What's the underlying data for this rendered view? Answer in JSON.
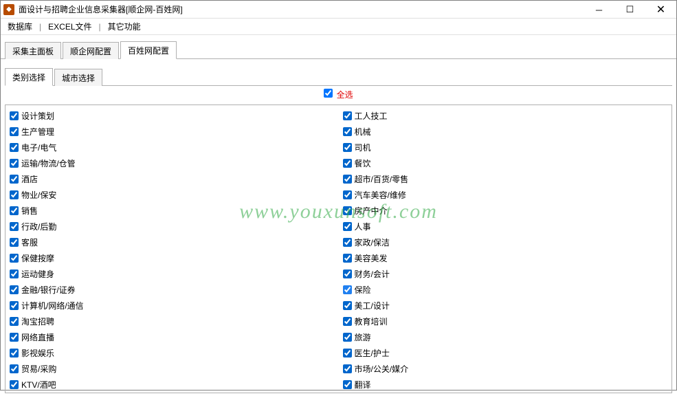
{
  "window": {
    "title": "面设计与招聘企业信息采集器[顺企网-百姓网]"
  },
  "menu": {
    "database": "数据库",
    "excel": "EXCEL文件",
    "other": "其它功能"
  },
  "tabs_main": {
    "collect": "采集主面板",
    "shunqi": "顺企网配置",
    "baixing": "百姓网配置"
  },
  "tabs_inner": {
    "category": "类别选择",
    "city": "城市选择"
  },
  "select_all": "全选",
  "watermark": "www.youxunsoft.com",
  "categories_left": [
    "设计策划",
    "生产管理",
    "电子/电气",
    "运输/物流/仓管",
    "酒店",
    "物业/保安",
    "销售",
    "行政/后勤",
    "客服",
    "保健按摩",
    "运动健身",
    "金融/银行/证券",
    "计算机/网络/通信",
    "淘宝招聘",
    "网络直播",
    "影视娱乐",
    "贸易/采购",
    "KTV/酒吧"
  ],
  "categories_right": [
    "工人技工",
    "机械",
    "司机",
    "餐饮",
    "超市/百货/零售",
    "汽车美容/维修",
    "房产中介",
    "人事",
    "家政/保洁",
    "美容美发",
    "财务/会计",
    "保险",
    "美工/设计",
    "教育培训",
    "旅游",
    "医生/护士",
    "市场/公关/媒介",
    "翻译"
  ]
}
